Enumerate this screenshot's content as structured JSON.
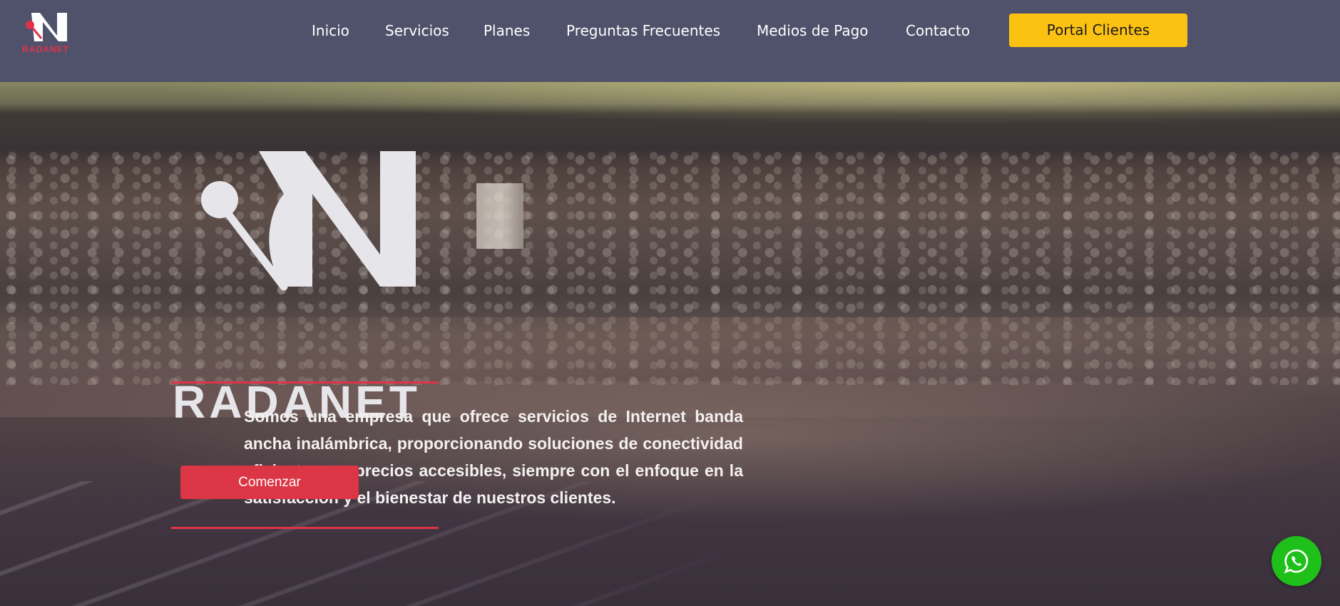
{
  "brand": {
    "name": "RADANET",
    "primary_color": "#e0334a",
    "header_bg": "#50526b",
    "accent_color": "#fcc212"
  },
  "nav": {
    "items": [
      {
        "label": "Inicio"
      },
      {
        "label": "Servicios"
      },
      {
        "label": "Planes"
      },
      {
        "label": "Preguntas Frecuentes"
      },
      {
        "label": "Medios de Pago"
      },
      {
        "label": "Contacto"
      }
    ],
    "portal_button": "Portal Clientes"
  },
  "hero": {
    "logo_text": "RADANET",
    "description": "Somos una empresa que ofrece servicios de Internet banda ancha inalámbrica, proporcionando soluciones de conectividad eficientes y a precios accesibles, siempre con el enfoque en la satisfacción y el bienestar de nuestros clientes.",
    "cta_label": "Comenzar"
  },
  "floating": {
    "whatsapp_icon": "whatsapp-icon",
    "whatsapp_color": "#1fc01a"
  }
}
